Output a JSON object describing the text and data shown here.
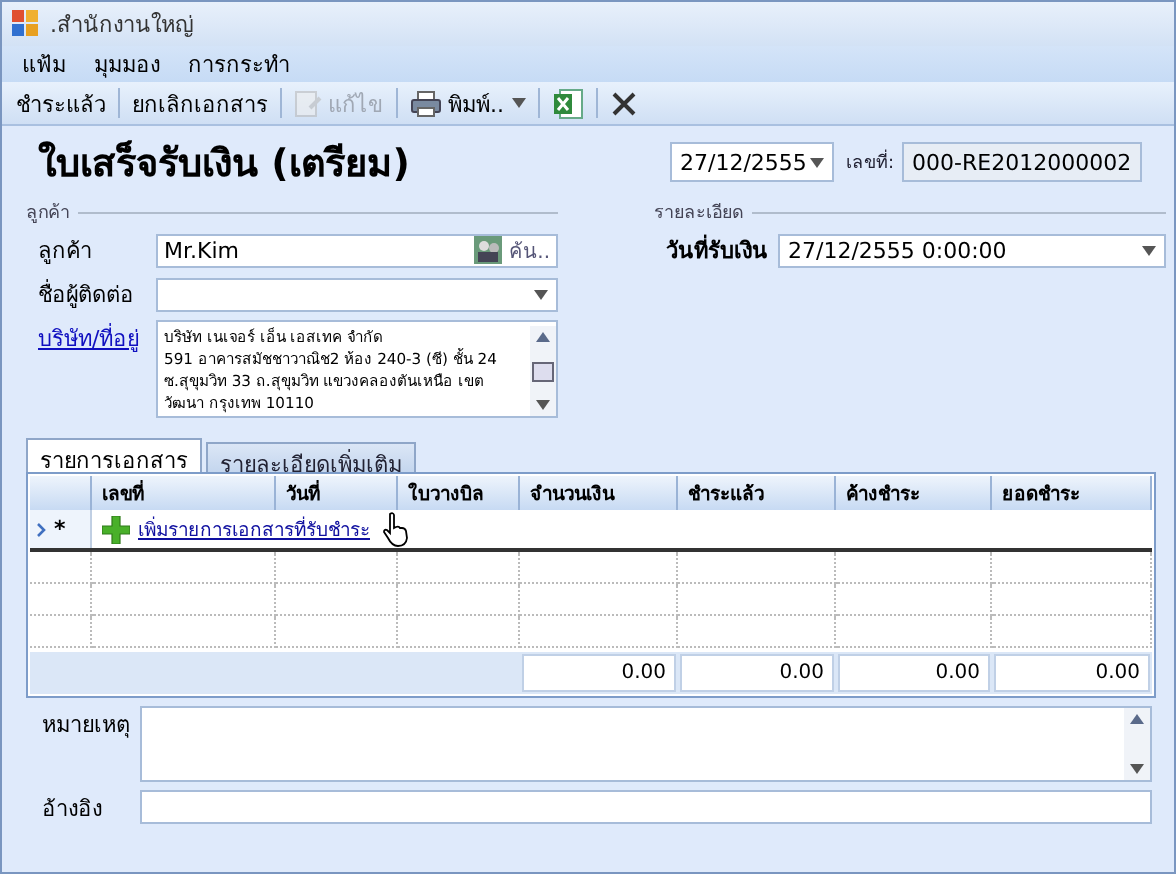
{
  "window": {
    "title": ".สำนักงานใหญ่"
  },
  "menu": [
    "แฟ้ม",
    "มุมมอง",
    "การกระทำ"
  ],
  "toolbar": [
    {
      "kind": "text",
      "label": "ชำระแล้ว",
      "disabled": false
    },
    {
      "kind": "text",
      "label": "ยกเลิกเอกสาร",
      "disabled": false
    },
    {
      "kind": "edit",
      "label": "แก้ไข",
      "disabled": true
    },
    {
      "kind": "print",
      "label": "พิมพ์..",
      "disabled": false
    },
    {
      "kind": "excel",
      "disabled": false
    },
    {
      "kind": "close",
      "disabled": false
    }
  ],
  "form_title": "ใบเสร็จรับเงิน (เตรียม)",
  "doc_date": "27/12/2555",
  "doc_number_label": "เลขที่:",
  "doc_number": "000-RE2012000002",
  "customer_section": "ลูกค้า",
  "details_section": "รายละเอียด",
  "customer": {
    "label": "ลูกค้า",
    "value": "Mr.Kim",
    "search": "ค้น.."
  },
  "contact": {
    "label": "ชื่อผู้ติดต่อ"
  },
  "address": {
    "label": "บริษัท/ที่อยู่",
    "lines": [
      "บริษัท เนเจอร์ เอ็น เอสเทค จำกัด",
      "591 อาคารสมัชชาวาณิช2 ห้อง 240-3 (ซี) ชั้น 24",
      "ซ.สุขุมวิท 33 ถ.สุขุมวิท แขวงคลองตันเหนือ เขต",
      "วัฒนา กรุงเทพ 10110"
    ]
  },
  "receive_date": {
    "label": "วันที่รับเงิน",
    "value": "27/12/2555 0:00:00"
  },
  "tabs": [
    {
      "label": "รายการเอกสาร",
      "selected": true
    },
    {
      "label": "รายละเอียดเพิ่มเติม",
      "selected": false
    }
  ],
  "table": {
    "columns": [
      "เลขที่",
      "วันที่",
      "ใบวางบิล",
      "จำนวนเงิน",
      "ชำระแล้ว",
      "ค้างชำระ",
      "ยอดชำระ"
    ],
    "new_row_marker": "*",
    "add_link": "เพิ่มรายการเอกสารที่รับชำระ",
    "totals": [
      "0.00",
      "0.00",
      "0.00",
      "0.00"
    ]
  },
  "remarks": {
    "label": "หมายเหตุ"
  },
  "reference": {
    "label": "อ้างอิง"
  }
}
